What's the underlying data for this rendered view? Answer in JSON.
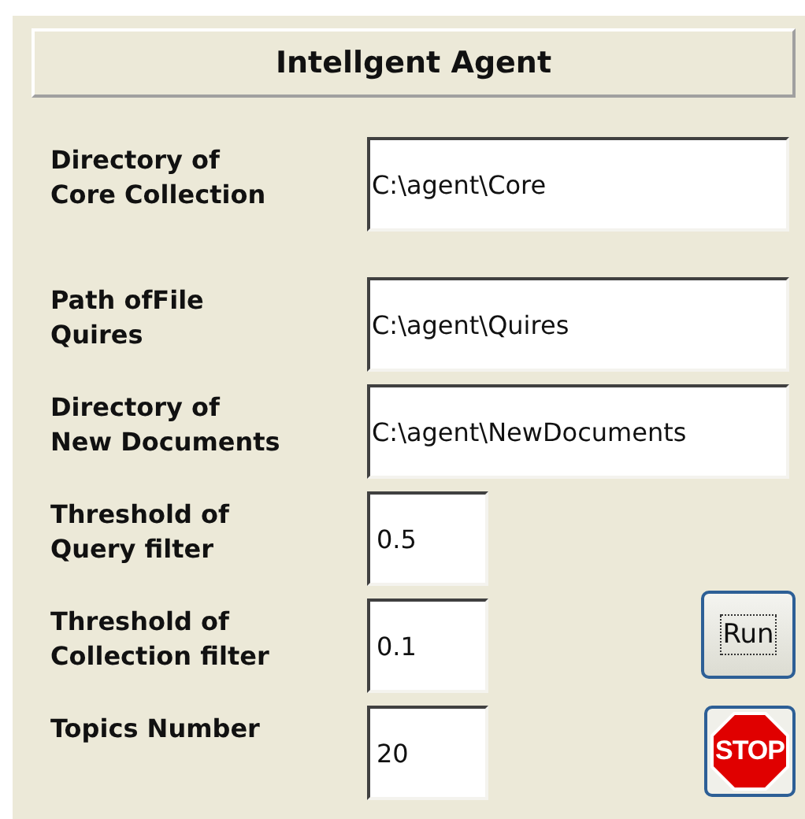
{
  "title": "Intellgent  Agent",
  "fields": [
    {
      "label": "Directory of\nCore Collection",
      "value": "C:\\agent\\Core",
      "kind": "wide"
    },
    {
      "label": "Path ofFile\nQuires",
      "value": "C:\\agent\\Quires",
      "kind": "wide"
    },
    {
      "label": "Directory of\nNew Documents",
      "value": "C:\\agent\\NewDocuments",
      "kind": "wide"
    },
    {
      "label": "Threshold of\nQuery filter",
      "value": "0.5",
      "kind": "narrow"
    },
    {
      "label": "Threshold of\nCollection filter",
      "value": "0.1",
      "kind": "narrow",
      "action": {
        "kind": "run",
        "label": "Run"
      }
    },
    {
      "label": "Topics Number",
      "value": "20",
      "kind": "narrow",
      "action": {
        "kind": "stop",
        "label": "STOP"
      }
    }
  ]
}
